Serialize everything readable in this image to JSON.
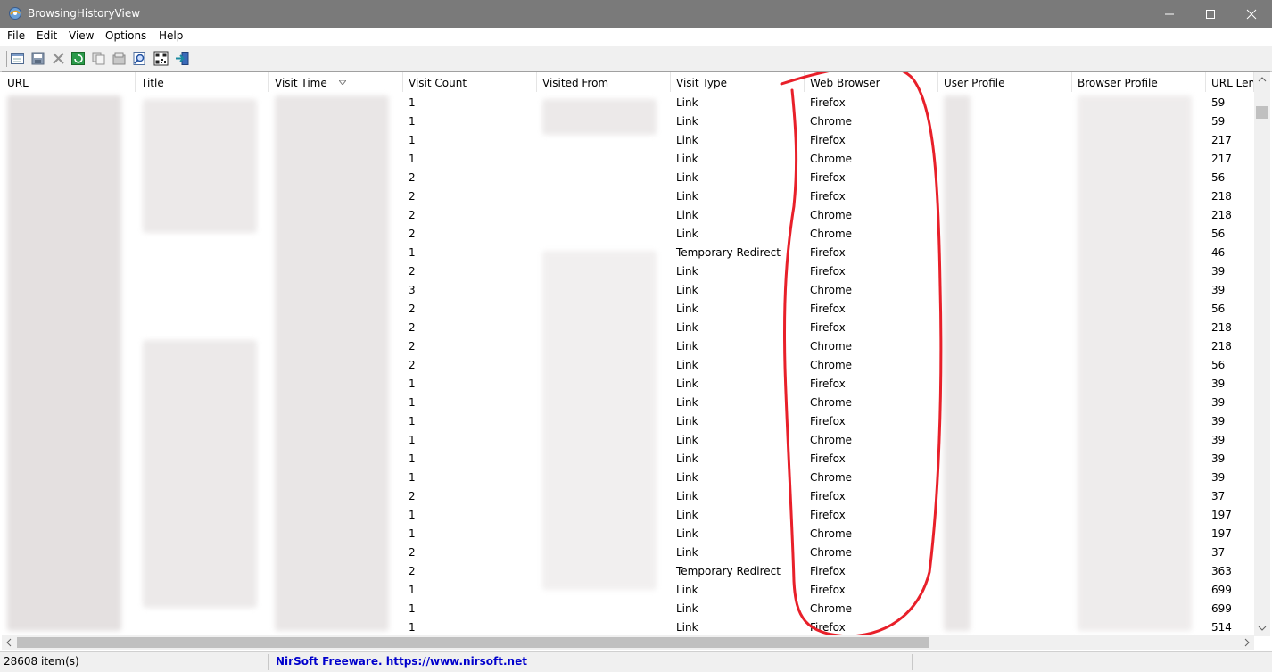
{
  "window": {
    "title": "BrowsingHistoryView"
  },
  "menu": [
    "File",
    "Edit",
    "View",
    "Options",
    "Help"
  ],
  "columns": [
    "URL",
    "Title",
    "Visit Time",
    "Visit Count",
    "Visited From",
    "Visit Type",
    "Web Browser",
    "User Profile",
    "Browser Profile",
    "URL Leng"
  ],
  "rows": [
    {
      "count": "1",
      "type": "Link",
      "browser": "Firefox",
      "len": "59"
    },
    {
      "count": "1",
      "type": "Link",
      "browser": "Chrome",
      "len": "59"
    },
    {
      "count": "1",
      "type": "Link",
      "browser": "Firefox",
      "len": "217"
    },
    {
      "count": "1",
      "type": "Link",
      "browser": "Chrome",
      "len": "217"
    },
    {
      "count": "2",
      "type": "Link",
      "browser": "Firefox",
      "len": "56"
    },
    {
      "count": "2",
      "type": "Link",
      "browser": "Firefox",
      "len": "218"
    },
    {
      "count": "2",
      "type": "Link",
      "browser": "Chrome",
      "len": "218"
    },
    {
      "count": "2",
      "type": "Link",
      "browser": "Chrome",
      "len": "56"
    },
    {
      "count": "1",
      "type": "Temporary Redirect",
      "browser": "Firefox",
      "len": "46"
    },
    {
      "count": "2",
      "type": "Link",
      "browser": "Firefox",
      "len": "39"
    },
    {
      "count": "3",
      "type": "Link",
      "browser": "Chrome",
      "len": "39"
    },
    {
      "count": "2",
      "type": "Link",
      "browser": "Firefox",
      "len": "56"
    },
    {
      "count": "2",
      "type": "Link",
      "browser": "Firefox",
      "len": "218"
    },
    {
      "count": "2",
      "type": "Link",
      "browser": "Chrome",
      "len": "218"
    },
    {
      "count": "2",
      "type": "Link",
      "browser": "Chrome",
      "len": "56"
    },
    {
      "count": "1",
      "type": "Link",
      "browser": "Firefox",
      "len": "39"
    },
    {
      "count": "1",
      "type": "Link",
      "browser": "Chrome",
      "len": "39"
    },
    {
      "count": "1",
      "type": "Link",
      "browser": "Firefox",
      "len": "39"
    },
    {
      "count": "1",
      "type": "Link",
      "browser": "Chrome",
      "len": "39"
    },
    {
      "count": "1",
      "type": "Link",
      "browser": "Firefox",
      "len": "39"
    },
    {
      "count": "1",
      "type": "Link",
      "browser": "Chrome",
      "len": "39"
    },
    {
      "count": "2",
      "type": "Link",
      "browser": "Firefox",
      "len": "37"
    },
    {
      "count": "1",
      "type": "Link",
      "browser": "Firefox",
      "len": "197"
    },
    {
      "count": "1",
      "type": "Link",
      "browser": "Chrome",
      "len": "197"
    },
    {
      "count": "2",
      "type": "Link",
      "browser": "Chrome",
      "len": "37"
    },
    {
      "count": "2",
      "type": "Temporary Redirect",
      "browser": "Firefox",
      "len": "363"
    },
    {
      "count": "1",
      "type": "Link",
      "browser": "Firefox",
      "len": "699"
    },
    {
      "count": "1",
      "type": "Link",
      "browser": "Chrome",
      "len": "699"
    },
    {
      "count": "1",
      "type": "Link",
      "browser": "Firefox",
      "len": "514"
    }
  ],
  "status": {
    "items": "28608 item(s)",
    "credit": "NirSoft Freeware. https://www.nirsoft.net"
  },
  "colors": {
    "annotation": "#e8202a",
    "credit_link": "#0000cc",
    "titlebar": "#7a7a7a"
  },
  "icons": [
    "app-icon",
    "html-report-icon",
    "save-icon",
    "delete-icon",
    "refresh-icon",
    "copy-icon",
    "properties-icon",
    "find-icon",
    "qr-code-icon",
    "exit-icon"
  ]
}
